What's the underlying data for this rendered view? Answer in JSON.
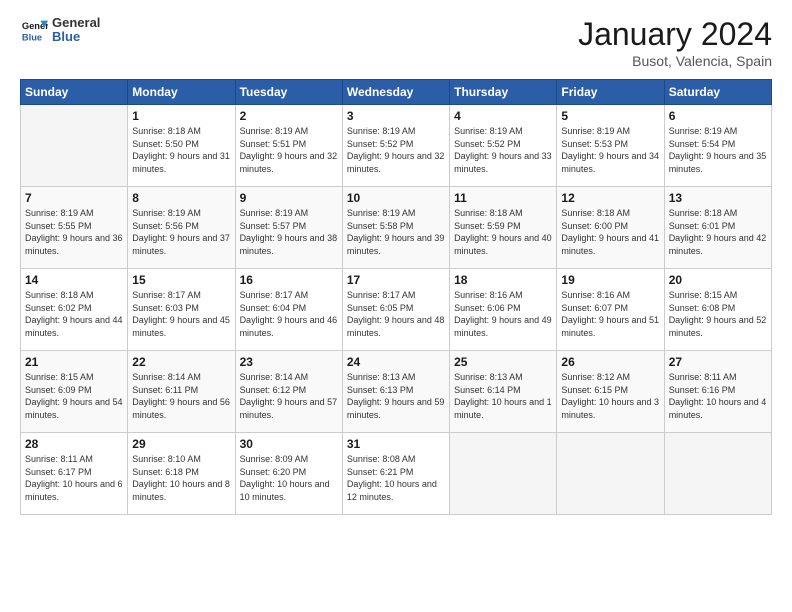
{
  "header": {
    "logo_general": "General",
    "logo_blue": "Blue",
    "month": "January 2024",
    "location": "Busot, Valencia, Spain"
  },
  "weekdays": [
    "Sunday",
    "Monday",
    "Tuesday",
    "Wednesday",
    "Thursday",
    "Friday",
    "Saturday"
  ],
  "weeks": [
    [
      {
        "day": "",
        "empty": true
      },
      {
        "day": "1",
        "sunrise": "Sunrise: 8:18 AM",
        "sunset": "Sunset: 5:50 PM",
        "daylight": "Daylight: 9 hours and 31 minutes."
      },
      {
        "day": "2",
        "sunrise": "Sunrise: 8:19 AM",
        "sunset": "Sunset: 5:51 PM",
        "daylight": "Daylight: 9 hours and 32 minutes."
      },
      {
        "day": "3",
        "sunrise": "Sunrise: 8:19 AM",
        "sunset": "Sunset: 5:52 PM",
        "daylight": "Daylight: 9 hours and 32 minutes."
      },
      {
        "day": "4",
        "sunrise": "Sunrise: 8:19 AM",
        "sunset": "Sunset: 5:52 PM",
        "daylight": "Daylight: 9 hours and 33 minutes."
      },
      {
        "day": "5",
        "sunrise": "Sunrise: 8:19 AM",
        "sunset": "Sunset: 5:53 PM",
        "daylight": "Daylight: 9 hours and 34 minutes."
      },
      {
        "day": "6",
        "sunrise": "Sunrise: 8:19 AM",
        "sunset": "Sunset: 5:54 PM",
        "daylight": "Daylight: 9 hours and 35 minutes."
      }
    ],
    [
      {
        "day": "7",
        "sunrise": "Sunrise: 8:19 AM",
        "sunset": "Sunset: 5:55 PM",
        "daylight": "Daylight: 9 hours and 36 minutes."
      },
      {
        "day": "8",
        "sunrise": "Sunrise: 8:19 AM",
        "sunset": "Sunset: 5:56 PM",
        "daylight": "Daylight: 9 hours and 37 minutes."
      },
      {
        "day": "9",
        "sunrise": "Sunrise: 8:19 AM",
        "sunset": "Sunset: 5:57 PM",
        "daylight": "Daylight: 9 hours and 38 minutes."
      },
      {
        "day": "10",
        "sunrise": "Sunrise: 8:19 AM",
        "sunset": "Sunset: 5:58 PM",
        "daylight": "Daylight: 9 hours and 39 minutes."
      },
      {
        "day": "11",
        "sunrise": "Sunrise: 8:18 AM",
        "sunset": "Sunset: 5:59 PM",
        "daylight": "Daylight: 9 hours and 40 minutes."
      },
      {
        "day": "12",
        "sunrise": "Sunrise: 8:18 AM",
        "sunset": "Sunset: 6:00 PM",
        "daylight": "Daylight: 9 hours and 41 minutes."
      },
      {
        "day": "13",
        "sunrise": "Sunrise: 8:18 AM",
        "sunset": "Sunset: 6:01 PM",
        "daylight": "Daylight: 9 hours and 42 minutes."
      }
    ],
    [
      {
        "day": "14",
        "sunrise": "Sunrise: 8:18 AM",
        "sunset": "Sunset: 6:02 PM",
        "daylight": "Daylight: 9 hours and 44 minutes."
      },
      {
        "day": "15",
        "sunrise": "Sunrise: 8:17 AM",
        "sunset": "Sunset: 6:03 PM",
        "daylight": "Daylight: 9 hours and 45 minutes."
      },
      {
        "day": "16",
        "sunrise": "Sunrise: 8:17 AM",
        "sunset": "Sunset: 6:04 PM",
        "daylight": "Daylight: 9 hours and 46 minutes."
      },
      {
        "day": "17",
        "sunrise": "Sunrise: 8:17 AM",
        "sunset": "Sunset: 6:05 PM",
        "daylight": "Daylight: 9 hours and 48 minutes."
      },
      {
        "day": "18",
        "sunrise": "Sunrise: 8:16 AM",
        "sunset": "Sunset: 6:06 PM",
        "daylight": "Daylight: 9 hours and 49 minutes."
      },
      {
        "day": "19",
        "sunrise": "Sunrise: 8:16 AM",
        "sunset": "Sunset: 6:07 PM",
        "daylight": "Daylight: 9 hours and 51 minutes."
      },
      {
        "day": "20",
        "sunrise": "Sunrise: 8:15 AM",
        "sunset": "Sunset: 6:08 PM",
        "daylight": "Daylight: 9 hours and 52 minutes."
      }
    ],
    [
      {
        "day": "21",
        "sunrise": "Sunrise: 8:15 AM",
        "sunset": "Sunset: 6:09 PM",
        "daylight": "Daylight: 9 hours and 54 minutes."
      },
      {
        "day": "22",
        "sunrise": "Sunrise: 8:14 AM",
        "sunset": "Sunset: 6:11 PM",
        "daylight": "Daylight: 9 hours and 56 minutes."
      },
      {
        "day": "23",
        "sunrise": "Sunrise: 8:14 AM",
        "sunset": "Sunset: 6:12 PM",
        "daylight": "Daylight: 9 hours and 57 minutes."
      },
      {
        "day": "24",
        "sunrise": "Sunrise: 8:13 AM",
        "sunset": "Sunset: 6:13 PM",
        "daylight": "Daylight: 9 hours and 59 minutes."
      },
      {
        "day": "25",
        "sunrise": "Sunrise: 8:13 AM",
        "sunset": "Sunset: 6:14 PM",
        "daylight": "Daylight: 10 hours and 1 minute."
      },
      {
        "day": "26",
        "sunrise": "Sunrise: 8:12 AM",
        "sunset": "Sunset: 6:15 PM",
        "daylight": "Daylight: 10 hours and 3 minutes."
      },
      {
        "day": "27",
        "sunrise": "Sunrise: 8:11 AM",
        "sunset": "Sunset: 6:16 PM",
        "daylight": "Daylight: 10 hours and 4 minutes."
      }
    ],
    [
      {
        "day": "28",
        "sunrise": "Sunrise: 8:11 AM",
        "sunset": "Sunset: 6:17 PM",
        "daylight": "Daylight: 10 hours and 6 minutes."
      },
      {
        "day": "29",
        "sunrise": "Sunrise: 8:10 AM",
        "sunset": "Sunset: 6:18 PM",
        "daylight": "Daylight: 10 hours and 8 minutes."
      },
      {
        "day": "30",
        "sunrise": "Sunrise: 8:09 AM",
        "sunset": "Sunset: 6:20 PM",
        "daylight": "Daylight: 10 hours and 10 minutes."
      },
      {
        "day": "31",
        "sunrise": "Sunrise: 8:08 AM",
        "sunset": "Sunset: 6:21 PM",
        "daylight": "Daylight: 10 hours and 12 minutes."
      },
      {
        "day": "",
        "empty": true
      },
      {
        "day": "",
        "empty": true
      },
      {
        "day": "",
        "empty": true
      }
    ]
  ]
}
